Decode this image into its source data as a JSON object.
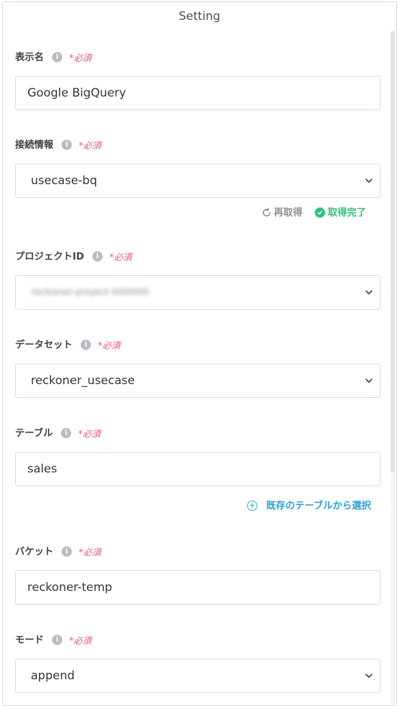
{
  "header": {
    "title": "Setting"
  },
  "common": {
    "required": "*必須",
    "info_glyph": "i"
  },
  "fields": {
    "display_name": {
      "label": "表示名",
      "value": "Google BigQuery"
    },
    "connection": {
      "label": "接続情報",
      "value": "usecase-bq",
      "refresh_label": "再取得",
      "status_label": "取得完了"
    },
    "project_id": {
      "label": "プロジェクトID",
      "value": "reckoner-project-000000"
    },
    "dataset": {
      "label": "データセット",
      "value": "reckoner_usecase"
    },
    "table": {
      "label": "テーブル",
      "value": "sales",
      "choose_existing_label": "既存のテーブルから選択"
    },
    "bucket": {
      "label": "バケット",
      "value": "reckoner-temp"
    },
    "mode": {
      "label": "モード",
      "value": "append"
    }
  },
  "colors": {
    "required": "#e0556a",
    "success": "#2ec27e",
    "link": "#2f9fd3"
  }
}
